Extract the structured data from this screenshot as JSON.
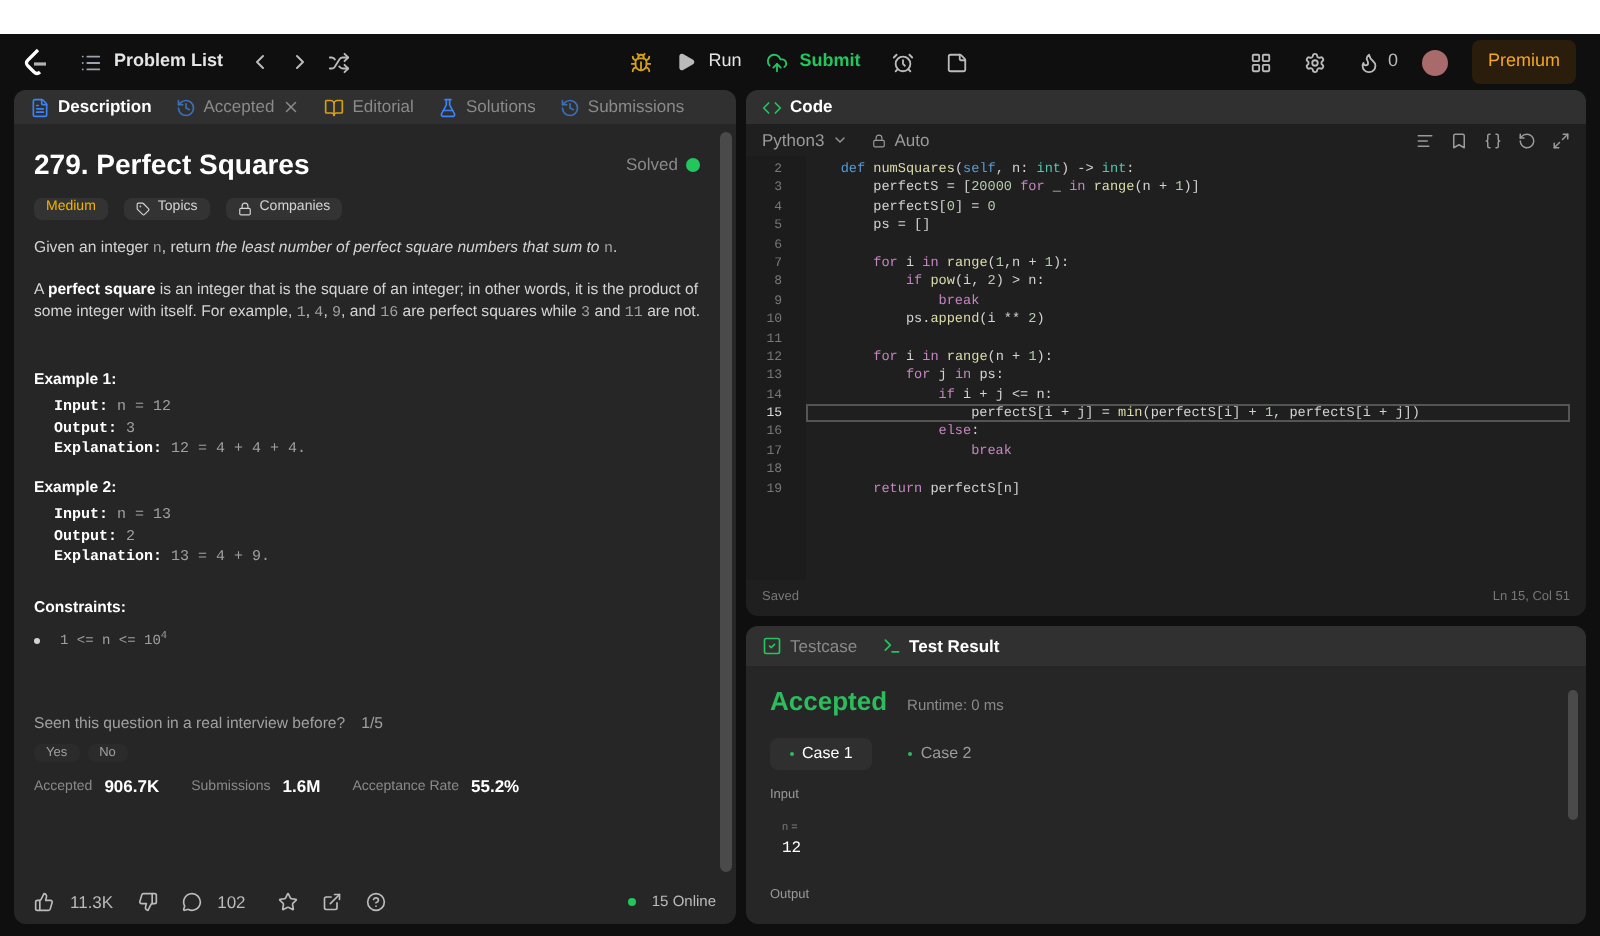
{
  "top_bar": {
    "nav_title": "Problem List",
    "run": "Run",
    "submit": "Submit",
    "streak": "0",
    "premium": "Premium"
  },
  "description_panel": {
    "tabs": [
      {
        "label": "Description",
        "selected": true,
        "closable": false
      },
      {
        "label": "Accepted",
        "selected": false,
        "closable": true
      },
      {
        "label": "Editorial",
        "selected": false,
        "closable": false
      },
      {
        "label": "Solutions",
        "selected": false,
        "closable": false
      },
      {
        "label": "Submissions",
        "selected": false,
        "closable": false
      }
    ],
    "title": "279. Perfect Squares",
    "status": "Solved",
    "difficulty": "Medium",
    "tags": [
      {
        "label": "Topics",
        "kind": "tag"
      },
      {
        "label": "Companies",
        "kind": "lock"
      }
    ],
    "paragraphs": [
      [
        {
          "text": "Given an integer ",
          "kind": "text"
        },
        {
          "text": "n",
          "kind": "code"
        },
        {
          "text": ", return ",
          "kind": "text"
        },
        {
          "text": "the least number of perfect square numbers that sum to ",
          "kind": "italic"
        },
        {
          "text": "n",
          "kind": "code"
        },
        {
          "text": ".",
          "kind": "text"
        }
      ],
      [
        {
          "text": "A ",
          "kind": "text"
        },
        {
          "text": "perfect square",
          "kind": "bold"
        },
        {
          "text": " is an integer that is the square of an integer; in other words, it is the product of some integer with itself. For example, ",
          "kind": "text"
        },
        {
          "text": "1",
          "kind": "code"
        },
        {
          "text": ", ",
          "kind": "text"
        },
        {
          "text": "4",
          "kind": "code"
        },
        {
          "text": ", ",
          "kind": "text"
        },
        {
          "text": "9",
          "kind": "code"
        },
        {
          "text": ", and ",
          "kind": "text"
        },
        {
          "text": "16",
          "kind": "code"
        },
        {
          "text": " are perfect squares while ",
          "kind": "text"
        },
        {
          "text": "3",
          "kind": "code"
        },
        {
          "text": " and ",
          "kind": "text"
        },
        {
          "text": "11",
          "kind": "code"
        },
        {
          "text": " are not.",
          "kind": "text"
        }
      ]
    ],
    "examples": [
      {
        "heading": "Example 1:",
        "lines": [
          {
            "label": "Input:",
            "value": "n = 12"
          },
          {
            "label": "Output:",
            "value": "3"
          },
          {
            "label": "Explanation:",
            "value": "12 = 4 + 4 + 4."
          }
        ]
      },
      {
        "heading": "Example 2:",
        "lines": [
          {
            "label": "Input:",
            "value": "n = 13"
          },
          {
            "label": "Output:",
            "value": "2"
          },
          {
            "label": "Explanation:",
            "value": "13 = 4 + 9."
          }
        ]
      }
    ],
    "constraints": {
      "heading": "Constraints:",
      "items": [
        "1 <= n <= 10$^{4}$"
      ]
    },
    "interview": {
      "question": "Seen this question in a real interview before?",
      "count": "1/5",
      "buttons": [
        "Yes",
        "No"
      ]
    },
    "stats": [
      {
        "label": "Accepted",
        "value": "906.7K"
      },
      {
        "label": "Submissions",
        "value": "1.6M"
      },
      {
        "label": "Acceptance Rate",
        "value": "55.2%"
      }
    ],
    "footer": {
      "likes": "11.3K",
      "comments": "102",
      "online": "15 Online"
    }
  },
  "code_panel": {
    "title": "Code",
    "language": "Python3",
    "mode": "Auto",
    "lines": [
      {
        "number": "2",
        "selected": false,
        "tokens": [
          {
            "text": "    def",
            "kind": "def"
          },
          {
            "text": " numSquares",
            "kind": "fn"
          },
          {
            "text": "(",
            "kind": "plain"
          },
          {
            "text": "self",
            "kind": "def"
          },
          {
            "text": ", n: ",
            "kind": "plain"
          },
          {
            "text": "int",
            "kind": "type"
          },
          {
            "text": ") -> ",
            "kind": "plain"
          },
          {
            "text": "int",
            "kind": "type"
          },
          {
            "text": ":",
            "kind": "plain"
          }
        ]
      },
      {
        "number": "3",
        "selected": false,
        "tokens": [
          {
            "text": "        perfectS = [",
            "kind": "plain"
          },
          {
            "text": "20000",
            "kind": "num"
          },
          {
            "text": " for",
            "kind": "kw"
          },
          {
            "text": " _ ",
            "kind": "plain"
          },
          {
            "text": "in",
            "kind": "kw"
          },
          {
            "text": " range",
            "kind": "fn"
          },
          {
            "text": "(n + ",
            "kind": "plain"
          },
          {
            "text": "1",
            "kind": "num"
          },
          {
            "text": ")]",
            "kind": "plain"
          }
        ]
      },
      {
        "number": "4",
        "selected": false,
        "tokens": [
          {
            "text": "        perfectS[",
            "kind": "plain"
          },
          {
            "text": "0",
            "kind": "num"
          },
          {
            "text": "] = ",
            "kind": "plain"
          },
          {
            "text": "0",
            "kind": "num"
          }
        ]
      },
      {
        "number": "5",
        "selected": false,
        "tokens": [
          {
            "text": "        ps = []",
            "kind": "plain"
          }
        ]
      },
      {
        "number": "6",
        "selected": false
      },
      {
        "number": "7",
        "selected": false,
        "tokens": [
          {
            "text": "        for",
            "kind": "kw"
          },
          {
            "text": " i ",
            "kind": "plain"
          },
          {
            "text": "in",
            "kind": "kw"
          },
          {
            "text": " range",
            "kind": "fn"
          },
          {
            "text": "(",
            "kind": "plain"
          },
          {
            "text": "1",
            "kind": "num"
          },
          {
            "text": ",n + ",
            "kind": "plain"
          },
          {
            "text": "1",
            "kind": "num"
          },
          {
            "text": "):",
            "kind": "plain"
          }
        ]
      },
      {
        "number": "8",
        "selected": false,
        "tokens": [
          {
            "text": "            if",
            "kind": "kw"
          },
          {
            "text": " pow",
            "kind": "fn"
          },
          {
            "text": "(i, ",
            "kind": "plain"
          },
          {
            "text": "2",
            "kind": "num"
          },
          {
            "text": ") > n:",
            "kind": "plain"
          }
        ]
      },
      {
        "number": "9",
        "selected": false,
        "tokens": [
          {
            "text": "                break",
            "kind": "kw"
          }
        ]
      },
      {
        "number": "10",
        "selected": false,
        "tokens": [
          {
            "text": "            ps.",
            "kind": "plain"
          },
          {
            "text": "append",
            "kind": "fn"
          },
          {
            "text": "(i ** ",
            "kind": "plain"
          },
          {
            "text": "2",
            "kind": "num"
          },
          {
            "text": ")",
            "kind": "plain"
          }
        ]
      },
      {
        "number": "11",
        "selected": false
      },
      {
        "number": "12",
        "selected": false,
        "tokens": [
          {
            "text": "        for",
            "kind": "kw"
          },
          {
            "text": " i ",
            "kind": "plain"
          },
          {
            "text": "in",
            "kind": "kw"
          },
          {
            "text": " range",
            "kind": "fn"
          },
          {
            "text": "(n + ",
            "kind": "plain"
          },
          {
            "text": "1",
            "kind": "num"
          },
          {
            "text": "):",
            "kind": "plain"
          }
        ]
      },
      {
        "number": "13",
        "selected": false,
        "tokens": [
          {
            "text": "            for",
            "kind": "kw"
          },
          {
            "text": " j ",
            "kind": "plain"
          },
          {
            "text": "in",
            "kind": "kw"
          },
          {
            "text": " ps:",
            "kind": "plain"
          }
        ]
      },
      {
        "number": "14",
        "selected": false,
        "tokens": [
          {
            "text": "                if",
            "kind": "kw"
          },
          {
            "text": " i + j <= n:",
            "kind": "plain"
          }
        ]
      },
      {
        "number": "15",
        "selected": true,
        "tokens": [
          {
            "text": "                    perfectS[i + j] = ",
            "kind": "plain"
          },
          {
            "text": "min",
            "kind": "fn"
          },
          {
            "text": "(perfectS[i] + ",
            "kind": "plain"
          },
          {
            "text": "1",
            "kind": "num"
          },
          {
            "text": ", perfectS[i + j])",
            "kind": "plain"
          }
        ]
      },
      {
        "number": "16",
        "selected": false,
        "tokens": [
          {
            "text": "                else",
            "kind": "kw"
          },
          {
            "text": ":",
            "kind": "plain"
          }
        ]
      },
      {
        "number": "17",
        "selected": false,
        "tokens": [
          {
            "text": "                    break",
            "kind": "kw"
          }
        ]
      },
      {
        "number": "18",
        "selected": false
      },
      {
        "number": "19",
        "selected": false,
        "tokens": [
          {
            "text": "        return",
            "kind": "kw"
          },
          {
            "text": " perfectS[n]",
            "kind": "plain"
          }
        ]
      }
    ],
    "status": "Saved",
    "cursor": "Ln 15, Col 51"
  },
  "result_panel": {
    "tabs": [
      {
        "label": "Testcase",
        "selected": false
      },
      {
        "label": "Test Result",
        "selected": true
      }
    ],
    "verdict": "Accepted",
    "runtime": "Runtime: 0 ms",
    "cases": [
      {
        "label": "Case 1",
        "selected": true
      },
      {
        "label": "Case 2",
        "selected": false
      }
    ],
    "input_label": "Input",
    "params": [
      {
        "name": "n =",
        "value": "12"
      }
    ],
    "output_label": "Output"
  }
}
